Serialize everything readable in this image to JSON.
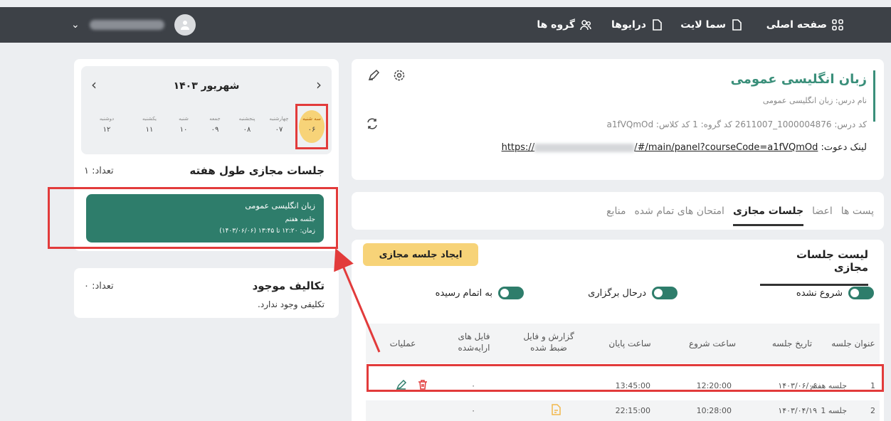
{
  "nav": {
    "home": "صفحه اصلی",
    "sama_lite": "سما لایت",
    "drives": "درایوها",
    "groups": "گروه ها"
  },
  "course": {
    "title": "زبان انگلیسی عمومی",
    "name_line": "نام درس: زبان انگلیسی عمومی",
    "codes_line": "کد درس: 1000004876_2611007    کد گروه: 1    کد کلاس: a1fVQmOd",
    "invite_label": "لینک دعوت:",
    "invite_prefix": "https://",
    "invite_suffix": "/#/main/panel?courseCode=a1fVQmOd"
  },
  "tabs": [
    "پست ها",
    "اعضا",
    "جلسات مجازی",
    "امتحان های تمام شده",
    "منابع"
  ],
  "sessions": {
    "title": "لیست جلسات مجازی",
    "create_button": "ایجاد جلسه مجازی",
    "toggles": [
      "شروع نشده",
      "درحال برگزاری",
      "به اتمام رسیده"
    ],
    "columns": [
      "عنوان جلسه",
      "تاریخ جلسه",
      "ساعت شروع",
      "ساعت پایان",
      "گزارش و فایل ضبط شده",
      "فایل های ارایه‌شده",
      "عملیات"
    ],
    "rows": [
      {
        "index": "1",
        "title": "جلسه هفتم",
        "date": "۱۴۰۳/۰۶/۰۶",
        "start": "12:20:00",
        "end": "13:45:00",
        "files": "۰"
      },
      {
        "index": "2",
        "title": "جلسه 1",
        "date": "۱۴۰۳/۰۴/۱۹",
        "start": "10:28:00",
        "end": "22:15:00",
        "files": "۰"
      }
    ]
  },
  "calendar": {
    "month": "شهریور ۱۴۰۳",
    "days": [
      {
        "name": "سه شنبه",
        "num": "۰۶"
      },
      {
        "name": "چهارشنبه",
        "num": "۰۷"
      },
      {
        "name": "پنجشنبه",
        "num": "۰۸"
      },
      {
        "name": "جمعه",
        "num": "۰۹"
      },
      {
        "name": "شنبه",
        "num": "۱۰"
      },
      {
        "name": "یکشنبه",
        "num": "۱۱"
      },
      {
        "name": "دوشنبه",
        "num": "۱۲"
      }
    ],
    "week_title": "جلسات مجازی طول هفته",
    "week_count": "تعداد: ۱",
    "session_tile": {
      "course": "زبان انگلیسی عمومی",
      "session": "جلسه هفتم",
      "time": "زمان: ۱۲:۲۰ تا ۱۳:۴۵ (۱۴۰۳/۰۶/۰۶)"
    }
  },
  "assignments": {
    "title": "تکالیف موجود",
    "count": "تعداد: ۰",
    "empty": "تکلیفی وجود ندارد."
  },
  "colors": {
    "topbar": "#3d4147",
    "accent": "#2e7d6b",
    "highlight": "#f7d378",
    "annotation": "#e23b3b"
  }
}
